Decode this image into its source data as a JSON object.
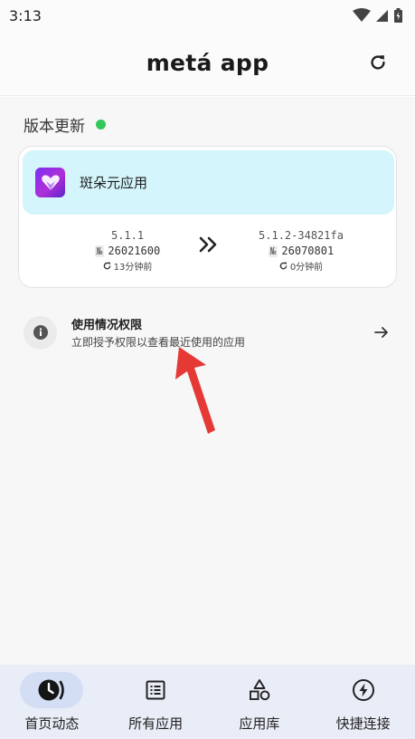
{
  "status_bar": {
    "time": "3:13"
  },
  "header": {
    "title": "metá app"
  },
  "section": {
    "title": "版本更新"
  },
  "update_card": {
    "app_name": "斑朵元应用",
    "current": {
      "version": "5.1.1",
      "build_prefix": "№",
      "build": "26021600",
      "age": "13分钟前"
    },
    "latest": {
      "version": "5.1.2-34821fa",
      "build_prefix": "№",
      "build": "26070801",
      "age": "0分钟前"
    }
  },
  "permission": {
    "title": "使用情况权限",
    "subtitle": "立即授予权限以查看最近使用的应用"
  },
  "bottom_nav": {
    "items": [
      {
        "label": "首页动态",
        "icon": "clock-icon",
        "active": true
      },
      {
        "label": "所有应用",
        "icon": "list-icon",
        "active": false
      },
      {
        "label": "应用库",
        "icon": "shapes-icon",
        "active": false
      },
      {
        "label": "快捷连接",
        "icon": "bolt-icon",
        "active": false
      }
    ]
  },
  "colors": {
    "accent_dot": "#34c759",
    "app_row_bg": "#d3f5fb",
    "nav_bg": "#e9edf7",
    "annotation_arrow": "#e53935"
  }
}
